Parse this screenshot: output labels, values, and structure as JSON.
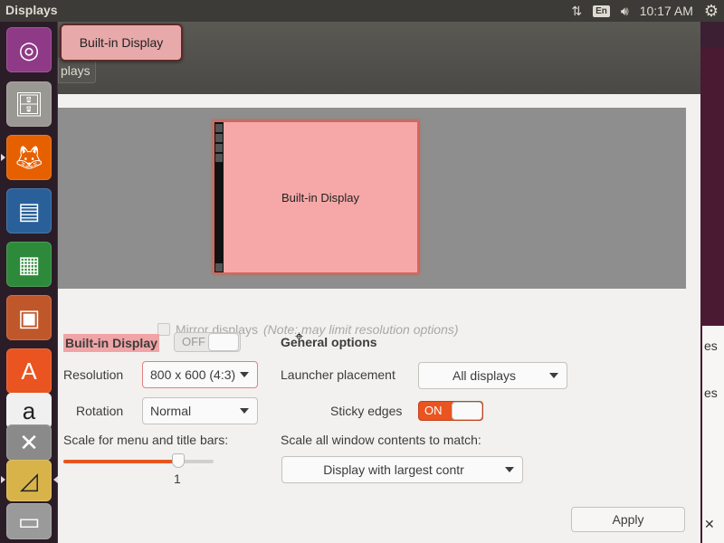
{
  "top_panel": {
    "title": "Displays",
    "network_icon": "network-updown-icon",
    "keyboard_layout": "En",
    "volume_icon": "volume-icon",
    "time": "10:17 AM",
    "settings_icon": "gear-icon"
  },
  "launcher": {
    "items": [
      {
        "name": "ubuntu-dash",
        "icon": "ubuntu-logo-icon",
        "color": "#77216f"
      },
      {
        "name": "files",
        "icon": "file-cabinet-icon",
        "color": "#8a8883"
      },
      {
        "name": "firefox",
        "icon": "firefox-icon",
        "color": "#e66000"
      },
      {
        "name": "libreoffice-writer",
        "icon": "writer-icon",
        "color": "#2a6099"
      },
      {
        "name": "libreoffice-calc",
        "icon": "calc-icon",
        "color": "#2d8a3a"
      },
      {
        "name": "libreoffice-impress",
        "icon": "impress-icon",
        "color": "#c0572a"
      },
      {
        "name": "software-center",
        "icon": "software-center-icon",
        "color": "#e95420"
      },
      {
        "name": "amazon",
        "icon": "amazon-icon",
        "color": "#eeeeee"
      },
      {
        "name": "system-settings",
        "icon": "settings-icon",
        "color": "#7a7a7a"
      },
      {
        "name": "displays",
        "icon": "displays-icon",
        "color": "#d8b34a"
      },
      {
        "name": "trash",
        "icon": "trash-icon",
        "color": "#9a9a9a"
      }
    ]
  },
  "window": {
    "tab_partial": "plays",
    "tooltip": "Built-in Display",
    "monitor_label": "Built-in Display",
    "mirror_label": "Mirror displays",
    "mirror_note": "(Note: may limit resolution options)",
    "display_name": "Built-in Display",
    "display_switch": "OFF",
    "resolution_label": "Resolution",
    "resolution_value": "800 x 600 (4:3)",
    "rotation_label": "Rotation",
    "rotation_value": "Normal",
    "scale_label": "Scale for menu and title bars:",
    "scale_value": "1",
    "general_title": "General options",
    "launcher_placement_label": "Launcher placement",
    "launcher_placement_value": "All displays",
    "sticky_edges_label": "Sticky edges",
    "sticky_edges_switch": "ON",
    "scale_all_label": "Scale all window contents to match:",
    "scale_all_value": "Display with largest contr",
    "apply_label": "Apply"
  },
  "background": {
    "char_1": "es",
    "char_2": "es",
    "char_3": "✕"
  },
  "colors": {
    "accent": "#e95420",
    "highlight": "#f0a4a6"
  }
}
